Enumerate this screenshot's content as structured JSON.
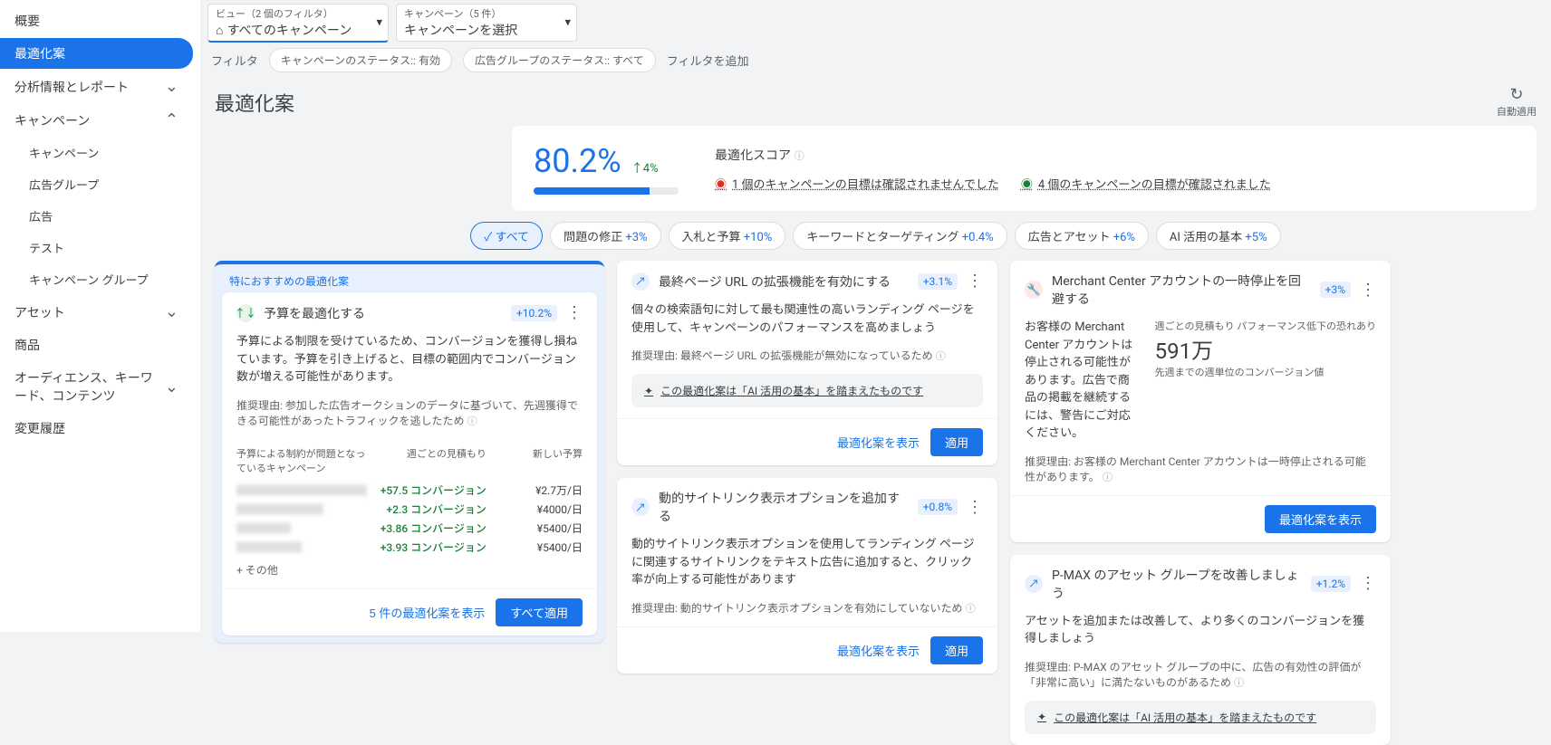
{
  "sidebar": {
    "items": [
      {
        "label": "概要"
      },
      {
        "label": "最適化案",
        "active": true
      },
      {
        "label": "分析情報とレポート",
        "expand": "down"
      },
      {
        "label": "キャンペーン",
        "expand": "up"
      },
      {
        "label": "キャンペーン",
        "indent": true
      },
      {
        "label": "広告グループ",
        "indent": true
      },
      {
        "label": "広告",
        "indent": true
      },
      {
        "label": "テスト",
        "indent": true
      },
      {
        "label": "キャンペーン グループ",
        "indent": true
      },
      {
        "label": "アセット",
        "expand": "down"
      },
      {
        "label": "商品"
      },
      {
        "label": "オーディエンス、キーワード、コンテンツ",
        "expand": "down"
      },
      {
        "label": "変更履歴"
      }
    ]
  },
  "topbar": {
    "view": {
      "label": "ビュー（2 個のフィルタ）",
      "value": "すべてのキャンペーン"
    },
    "campaign": {
      "label": "キャンペーン（5 件）",
      "value": "キャンペーンを選択"
    }
  },
  "filters": {
    "label": "フィルタ",
    "chips": [
      "キャンペーンのステータス:: 有効",
      "広告グループのステータス:: すべて"
    ],
    "add": "フィルタを追加"
  },
  "heading": "最適化案",
  "auto_apply": "自動適用",
  "score": {
    "value": "80.2%",
    "change": "↑4%",
    "title": "最適化スコア",
    "msg_warn": "1 個のキャンペーンの目標は確認されませんでした",
    "msg_ok": "4 個のキャンペーンの目標が確認されました"
  },
  "tabs": [
    {
      "label": "すべて",
      "pct": "",
      "active": true,
      "check": true
    },
    {
      "label": "問題の修正",
      "pct": "+3%"
    },
    {
      "label": "入札と予算",
      "pct": "+10%"
    },
    {
      "label": "キーワードとターゲティング",
      "pct": "+0.4%"
    },
    {
      "label": "広告とアセット",
      "pct": "+6%"
    },
    {
      "label": "AI 活用の基本",
      "pct": "+5%"
    }
  ],
  "featured": {
    "label": "特におすすめの最適化案",
    "title": "予算を最適化する",
    "pct": "+10.2%",
    "body": "予算による制限を受けているため、コンバージョンを獲得し損ねています。予算を引き上げると、目標の範囲内でコンバージョン数が増える可能性があります。",
    "reason": "推奨理由: 参加した広告オークションのデータに基づいて、先週獲得できる可能性があったトラフィックを逃したため",
    "table": {
      "headers": [
        "予算による制約が問題となっているキャンペーン",
        "週ごとの見積もり",
        "新しい予算"
      ],
      "rows": [
        {
          "conv": "+57.5 コンバージョン",
          "budget": "¥2.7万/日"
        },
        {
          "conv": "+2.3 コンバージョン",
          "budget": "¥4000/日"
        },
        {
          "conv": "+3.86 コンバージョン",
          "budget": "¥5400/日"
        },
        {
          "conv": "+3.93 コンバージョン",
          "budget": "¥5400/日"
        }
      ],
      "other": "+ その他"
    },
    "foot_link": "5 件の最適化案を表示",
    "foot_btn": "すべて適用"
  },
  "cards": [
    {
      "icon": "blue",
      "glyph": "↗",
      "title": "最終ページ URL の拡張機能を有効にする",
      "pct": "+3.1%",
      "body": "個々の検索語句に対して最も関連性の高いランディング ページを使用して、キャンペーンのパフォーマンスを高めましょう",
      "reason": "推奨理由: 最終ページ URL の拡張機能が無効になっているため",
      "ai_banner": "この最適化案は「AI 活用の基本」を踏まえたものです",
      "foot_link": "最適化案を表示",
      "foot_btn": "適用"
    },
    {
      "icon": "blue",
      "glyph": "↗",
      "title": "動的サイトリンク表示オプションを追加する",
      "pct": "+0.8%",
      "body": "動的サイトリンク表示オプションを使用してランディング ページに関連するサイトリンクをテキスト広告に追加すると、クリック率が向上する可能性があります",
      "reason": "推奨理由: 動的サイトリンク表示オプションを有効にしていないため",
      "foot_link": "最適化案を表示",
      "foot_btn": "適用"
    }
  ],
  "cards_right": [
    {
      "icon": "red",
      "glyph": "🔧",
      "title": "Merchant Center アカウントの一時停止を回避する",
      "pct": "+3%",
      "summary_text": "お客様の Merchant Center アカウントは停止される可能性があります。広告で商品の掲載を継続するには、警告にご対応ください。",
      "metric_label1": "週ごとの見積もり パフォーマンス低下の恐れあり",
      "metric_value": "591万",
      "metric_label2": "先週までの週単位のコンバージョン値",
      "reason": "推奨理由: お客様の Merchant Center アカウントは一時停止される可能性があります。",
      "foot_btn": "最適化案を表示"
    },
    {
      "icon": "blue",
      "glyph": "↗",
      "title": "P-MAX のアセット グループを改善しましょう",
      "pct": "+1.2%",
      "body": "アセットを追加または改善して、より多くのコンバージョンを獲得しましょう",
      "reason": "推奨理由: P-MAX のアセット グループの中に、広告の有効性の評価が「非常に高い」に満たないものがあるため",
      "ai_banner": "この最適化案は「AI 活用の基本」を踏まえたものです"
    }
  ]
}
